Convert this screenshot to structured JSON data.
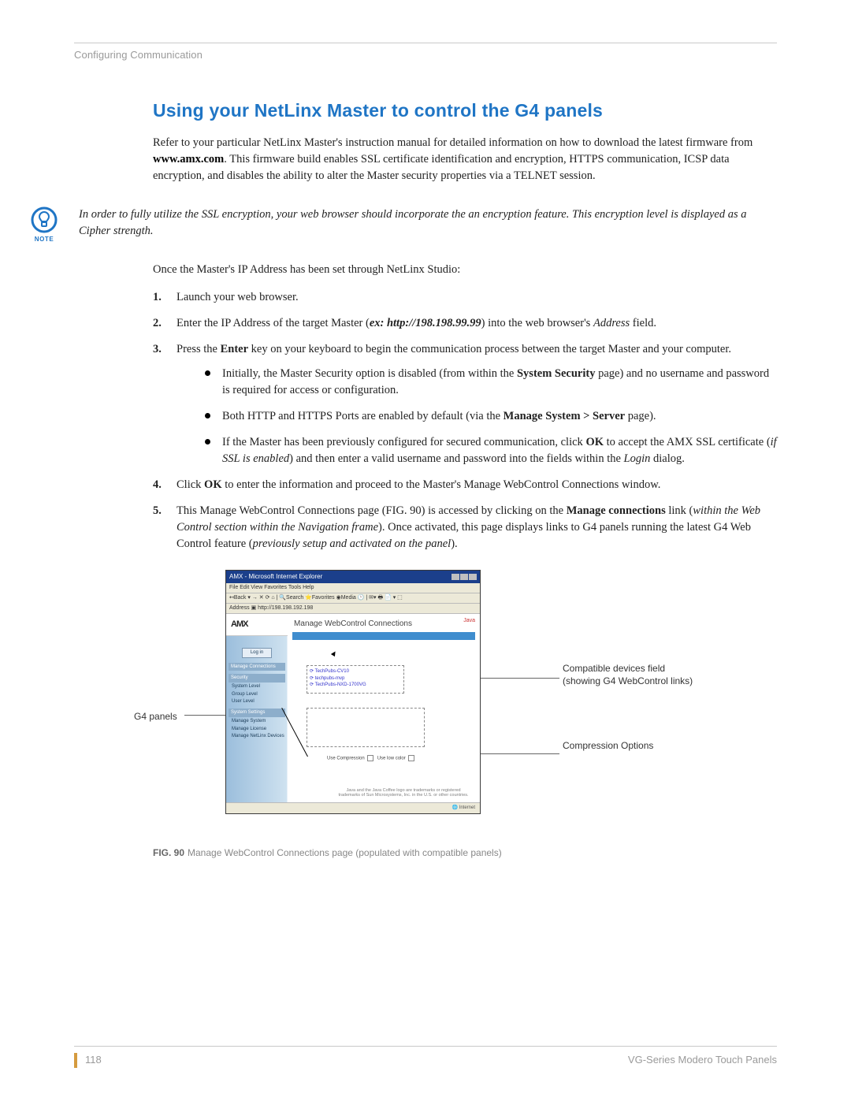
{
  "running_head": "Configuring Communication",
  "heading": "Using your NetLinx Master to control the G4 panels",
  "intro": {
    "pre": "Refer to your particular NetLinx Master's instruction manual for detailed information on how to download the latest firmware from ",
    "link": "www.amx.com",
    "post": ". This firmware build enables SSL certificate identification and encryption, HTTPS communication, ICSP data encryption, and disables the ability to alter the Master security properties via a TELNET session."
  },
  "note": {
    "label": "NOTE",
    "text": "In order to fully utilize the SSL encryption, your web browser should incorporate the an encryption feature. This encryption level is displayed as a Cipher strength."
  },
  "after_note": "Once the Master's IP Address has been set through NetLinx Studio:",
  "steps": {
    "s1": "Launch your web browser.",
    "s2": {
      "pre": "Enter the IP Address of the target Master (",
      "ex": "ex: http://198.198.99.99",
      "post": ") into the web browser's ",
      "addr": "Address",
      "tail": " field."
    },
    "s3": {
      "pre": "Press the ",
      "enter": "Enter",
      "post": " key on your keyboard to begin the communication process between the target Master and your computer."
    },
    "b1": {
      "pre": "Initially, the Master Security option is disabled (from within the ",
      "b": "System Security",
      "post": " page) and no username and password is required for access or configuration."
    },
    "b2": {
      "pre": "Both HTTP and HTTPS Ports are enabled by default (via the ",
      "b": "Manage System > Server",
      "post": " page)."
    },
    "b3": {
      "pre": "If the Master has been previously configured for secured communication, click ",
      "ok": "OK",
      "mid": " to accept the AMX SSL certificate (",
      "i": "if SSL is enabled",
      "post2": ") and then enter a valid username and password into the fields within the ",
      "login": "Login",
      "tail": " dialog."
    },
    "s4": {
      "pre": "Click ",
      "ok": "OK",
      "post": " to enter the information and proceed to the Master's Manage WebControl Connections window."
    },
    "s5": {
      "pre": "This Manage WebControl Connections page (FIG. 90) is accessed by clicking on the ",
      "b": "Manage connections",
      "mid": " link (",
      "i": "within the Web Control section within the Navigation frame",
      "post2": "). Once activated, this page displays links to G4 panels running the latest G4 Web Control feature (",
      "i2": "previously setup and activated on the panel",
      "tail": ")."
    }
  },
  "figure": {
    "left_label": "G4 panels",
    "right_label1": "Compatible devices field\n(showing G4 WebControl links)",
    "right_label2": "Compression Options",
    "browser_title": "AMX - Microsoft Internet Explorer",
    "menubar": "File   Edit   View   Favorites   Tools   Help",
    "toolbar": "↤Back ▾  →  ✕  ⟳  ⌂  |  🔍Search  ⭐Favorites  ◉Media  🕑  |  ✉▾ 🖶 📄 ▾ ⬚",
    "addr": "Address ▣  http://198.198.192.198",
    "logo": "AMX",
    "header_title": "Manage WebControl Connections",
    "java": "Java",
    "sidebar": {
      "login": "Log in",
      "grp1": "Manage Connections",
      "grp2": "Security",
      "i1": "System Level",
      "i2": "Group Level",
      "i3": "User Level",
      "grp3": "System Settings",
      "i4": "Manage System",
      "i5": "Manage License",
      "i6": "Manage NetLinx Devices"
    },
    "devices": {
      "d1": "TechPubs-CV10",
      "d2": "techpubs-mvp",
      "d3": "TechPubs-NXD-1700VG"
    },
    "comp": {
      "a": "Use Compression",
      "b": "Use low color"
    },
    "foot": "Java and the Java Coffee logo are trademarks or registered trademarks of Sun Microsystems, Inc. in the U.S. or other countries.",
    "status": "🌐 Internet"
  },
  "caption": {
    "b": "FIG. 90",
    "t": "Manage WebControl Connections page (populated with compatible panels)"
  },
  "footer": {
    "page": "118",
    "doc": "VG-Series Modero Touch Panels"
  }
}
